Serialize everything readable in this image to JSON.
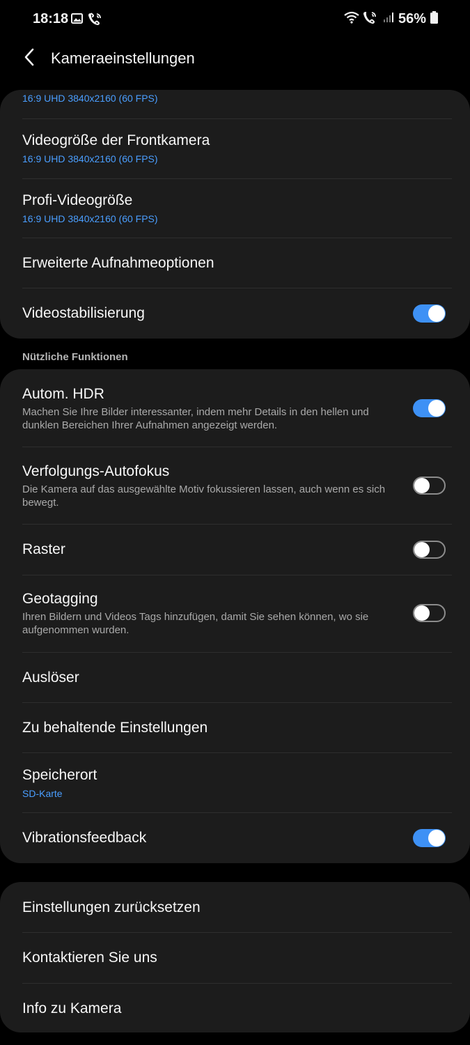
{
  "status_bar": {
    "time": "18:18",
    "battery_percent": "56%",
    "left_icons": [
      "gallery-icon",
      "call-icon"
    ],
    "right_icons": [
      "wifi-icon",
      "wifi-call-icon",
      "signal-icon",
      "battery-icon"
    ]
  },
  "app_bar": {
    "title": "Kameraeinstellungen",
    "back_icon": "chevron-left-icon"
  },
  "video_section": {
    "items": [
      {
        "title": "",
        "subtitle": "16:9 UHD 3840x2160 (60 FPS)"
      },
      {
        "title": "Videogröße der Frontkamera",
        "subtitle": "16:9 UHD 3840x2160 (60 FPS)"
      },
      {
        "title": "Profi-Videogröße",
        "subtitle": "16:9 UHD 3840x2160 (60 FPS)"
      },
      {
        "title": "Erweiterte Aufnahmeoptionen"
      },
      {
        "title": "Videostabilisierung",
        "toggle": true
      }
    ]
  },
  "useful_section": {
    "label": "Nützliche Funktionen",
    "items": [
      {
        "title": "Autom. HDR",
        "description": "Machen Sie Ihre Bilder interessanter, indem mehr Details in den hellen und dunklen Bereichen Ihrer Aufnahmen angezeigt werden.",
        "toggle": true
      },
      {
        "title": "Verfolgungs-Autofokus",
        "description": "Die Kamera auf das ausgewählte Motiv fokussieren lassen, auch wenn es sich bewegt.",
        "toggle": false
      },
      {
        "title": "Raster",
        "toggle": false
      },
      {
        "title": "Geotagging",
        "description": "Ihren Bildern und Videos Tags hinzufügen, damit Sie sehen können, wo sie aufgenommen wurden.",
        "toggle": false
      },
      {
        "title": "Auslöser"
      },
      {
        "title": "Zu behaltende Einstellungen"
      },
      {
        "title": "Speicherort",
        "subtitle": "SD-Karte"
      },
      {
        "title": "Vibrationsfeedback",
        "toggle": true
      }
    ]
  },
  "misc_section": {
    "items": [
      {
        "title": "Einstellungen zurücksetzen"
      },
      {
        "title": "Kontaktieren Sie uns"
      },
      {
        "title": "Info zu Kamera"
      }
    ]
  },
  "colors": {
    "background": "#000000",
    "card": "#1c1c1c",
    "accent": "#3e91f5",
    "subtitle": "#4a9eff"
  }
}
